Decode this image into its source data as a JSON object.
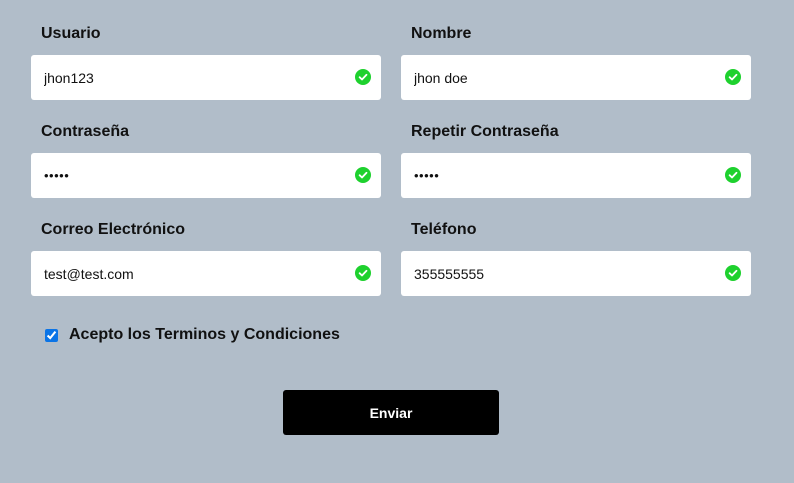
{
  "form": {
    "fields": [
      {
        "label": "Usuario",
        "value": "jhon123",
        "valid": true
      },
      {
        "label": "Nombre",
        "value": "jhon doe",
        "valid": true
      },
      {
        "label": "Contraseña",
        "value": "•••••",
        "valid": true
      },
      {
        "label": "Repetir Contraseña",
        "value": "•••••",
        "valid": true
      },
      {
        "label": "Correo Electrónico",
        "value": "test@test.com",
        "valid": true
      },
      {
        "label": "Teléfono",
        "value": "355555555",
        "valid": true
      }
    ],
    "terms_label": "Acepto los Terminos y Condiciones",
    "terms_checked": true,
    "submit_label": "Enviar"
  },
  "colors": {
    "background": "#b1bdc9",
    "valid_icon": "#1ed12e",
    "button": "#000000",
    "checkbox_accent": "#0b74e6"
  },
  "icons": {
    "valid": "check-circle-icon"
  }
}
